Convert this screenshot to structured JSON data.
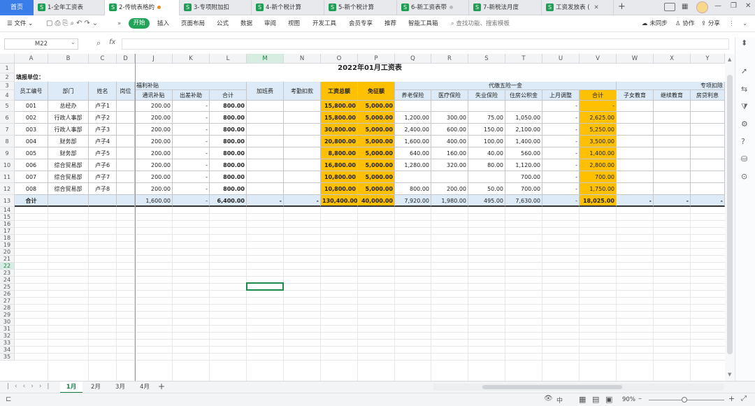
{
  "tabs": {
    "home": "首页",
    "items": [
      {
        "label": "1-全年工资表",
        "icon": "S"
      },
      {
        "label": "2-传统表格的",
        "icon": "S"
      },
      {
        "label": "3-专项附加扣",
        "icon": "S"
      },
      {
        "label": "4-新个税计算",
        "icon": "S"
      },
      {
        "label": "5-新个税计算",
        "icon": "S"
      },
      {
        "label": "6-新工资表带",
        "icon": "S"
      },
      {
        "label": "7-新税法月度",
        "icon": "S"
      },
      {
        "label": "工资发放表 (",
        "icon": "S"
      }
    ],
    "add": "+"
  },
  "menu": {
    "file": "文件",
    "start": "开始",
    "items": [
      "插入",
      "页面布局",
      "公式",
      "数据",
      "审阅",
      "视图",
      "开发工具",
      "会员专享",
      "推荐",
      "智能工具箱"
    ],
    "search": "查找功能、搜索模板",
    "unsync": "未同步",
    "collab": "协作",
    "share": "分享"
  },
  "formula": {
    "namebox": "M22",
    "fx": "fx",
    "value": ""
  },
  "columns": [
    "A",
    "B",
    "C",
    "D",
    "J",
    "K",
    "L",
    "M",
    "N",
    "O",
    "P",
    "Q",
    "R",
    "S",
    "T",
    "U",
    "V",
    "W",
    "X",
    "Y"
  ],
  "rows": [
    "1",
    "2",
    "3",
    "4",
    "5",
    "6",
    "7",
    "8",
    "9",
    "10",
    "11",
    "12",
    "13",
    "14",
    "15",
    "16",
    "17",
    "18",
    "19",
    "20",
    "21",
    "22",
    "23",
    "24",
    "25",
    "26",
    "27",
    "28",
    "29",
    "30",
    "31",
    "32",
    "33",
    "34",
    "35"
  ],
  "sheet": {
    "title": "2022年01月工资表",
    "unit_label": "填报单位：",
    "h_empno": "员工编号",
    "h_dept": "部门",
    "h_name": "姓名",
    "h_post": "岗位",
    "h_welfare": "福利补贴",
    "h_comm": "通讯补贴",
    "h_travel": "出差补助",
    "h_sum": "合计",
    "h_overtime": "加班费",
    "h_attend": "考勤扣款",
    "h_gross": "工资总额",
    "h_exempt": "免征额",
    "h_insurance": "代缴五险一金",
    "h_pension": "养老保险",
    "h_medical": "医疗保险",
    "h_unemp": "失业保险",
    "h_housing": "住房公积金",
    "h_adjust": "上月调整",
    "h_ins_sum": "合计",
    "h_special": "专项扣除",
    "h_child": "子女教育",
    "h_edu": "继续教育",
    "h_loan": "房贷利息",
    "data": [
      [
        "001",
        "总经办",
        "卢子1",
        "",
        "200.00",
        "-",
        "800.00",
        "",
        "",
        "15,800.00",
        "5,000.00",
        "",
        "",
        "",
        "",
        "-",
        "-",
        "",
        "",
        ""
      ],
      [
        "002",
        "行政人事部",
        "卢子2",
        "",
        "200.00",
        "-",
        "800.00",
        "",
        "",
        "15,800.00",
        "5,000.00",
        "1,200.00",
        "300.00",
        "75.00",
        "1,050.00",
        "-",
        "2,625.00",
        "",
        "",
        ""
      ],
      [
        "003",
        "行政人事部",
        "卢子3",
        "",
        "200.00",
        "-",
        "800.00",
        "",
        "",
        "30,800.00",
        "5,000.00",
        "2,400.00",
        "600.00",
        "150.00",
        "2,100.00",
        "-",
        "5,250.00",
        "",
        "",
        ""
      ],
      [
        "004",
        "财务部",
        "卢子4",
        "",
        "200.00",
        "-",
        "800.00",
        "",
        "",
        "20,800.00",
        "5,000.00",
        "1,600.00",
        "400.00",
        "100.00",
        "1,400.00",
        "-",
        "3,500.00",
        "",
        "",
        ""
      ],
      [
        "005",
        "财务部",
        "卢子5",
        "",
        "200.00",
        "-",
        "800.00",
        "",
        "",
        "8,800.00",
        "5,000.00",
        "640.00",
        "160.00",
        "40.00",
        "560.00",
        "-",
        "1,400.00",
        "",
        "",
        ""
      ],
      [
        "006",
        "综合贸易部",
        "卢子6",
        "",
        "200.00",
        "-",
        "800.00",
        "",
        "",
        "16,800.00",
        "5,000.00",
        "1,280.00",
        "320.00",
        "80.00",
        "1,120.00",
        "-",
        "2,800.00",
        "",
        "",
        ""
      ],
      [
        "007",
        "综合贸易部",
        "卢子7",
        "",
        "200.00",
        "-",
        "800.00",
        "",
        "",
        "10,800.00",
        "5,000.00",
        "",
        "",
        "",
        "700.00",
        "-",
        "700.00",
        "",
        "",
        ""
      ],
      [
        "008",
        "综合贸易部",
        "卢子8",
        "",
        "200.00",
        "-",
        "800.00",
        "",
        "",
        "10,800.00",
        "5,000.00",
        "800.00",
        "200.00",
        "50.00",
        "700.00",
        "-",
        "1,750.00",
        "",
        "",
        ""
      ]
    ],
    "total": [
      "合计",
      "",
      "",
      "",
      "1,600.00",
      "-",
      "6,400.00",
      "-",
      "-",
      "130,400.00",
      "40,000.00",
      "7,920.00",
      "1,980.00",
      "495.00",
      "7,630.00",
      "-",
      "18,025.00",
      "-",
      "-",
      "-"
    ]
  },
  "sheets": [
    "1月",
    "2月",
    "3月",
    "4月"
  ],
  "status": {
    "zoom": "90%",
    "input": "中"
  }
}
